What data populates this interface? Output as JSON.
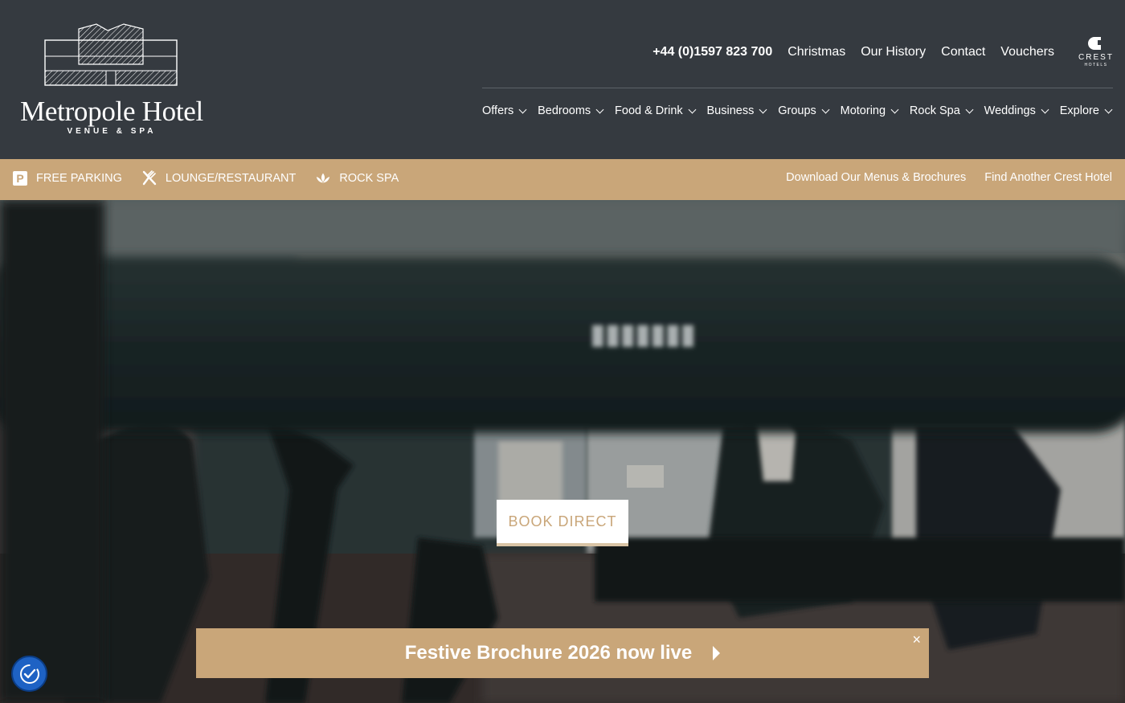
{
  "brand": {
    "name": "Metropole Hotel",
    "subtitle": "VENUE & SPA",
    "crest_name": "CREST",
    "crest_sub": "HOTELS"
  },
  "top_links": [
    {
      "label": "+44 (0)1597 823 700"
    },
    {
      "label": "Christmas"
    },
    {
      "label": "Our History"
    },
    {
      "label": "Contact"
    },
    {
      "label": "Vouchers"
    }
  ],
  "main_nav": [
    {
      "label": "Offers"
    },
    {
      "label": "Bedrooms"
    },
    {
      "label": "Food & Drink"
    },
    {
      "label": "Business"
    },
    {
      "label": "Groups"
    },
    {
      "label": "Motoring"
    },
    {
      "label": "Rock Spa"
    },
    {
      "label": "Weddings"
    },
    {
      "label": "Explore"
    }
  ],
  "amenities": [
    {
      "label": "FREE PARKING",
      "icon": "parking-icon"
    },
    {
      "label": "LOUNGE/RESTAURANT",
      "icon": "cutlery-icon"
    },
    {
      "label": "ROCK SPA",
      "icon": "lotus-icon"
    }
  ],
  "bar_links": [
    {
      "label": "Download Our Menus & Brochures"
    },
    {
      "label": "Find Another Crest Hotel"
    }
  ],
  "hero": {
    "cta_label": "BOOK DIRECT"
  },
  "banner": {
    "text": "Festive Brochure 2026 now live",
    "close": "×"
  },
  "colors": {
    "header_bg": "#353a40",
    "accent_gold": "#c9a679",
    "accessibility_blue": "#1e62c4"
  }
}
